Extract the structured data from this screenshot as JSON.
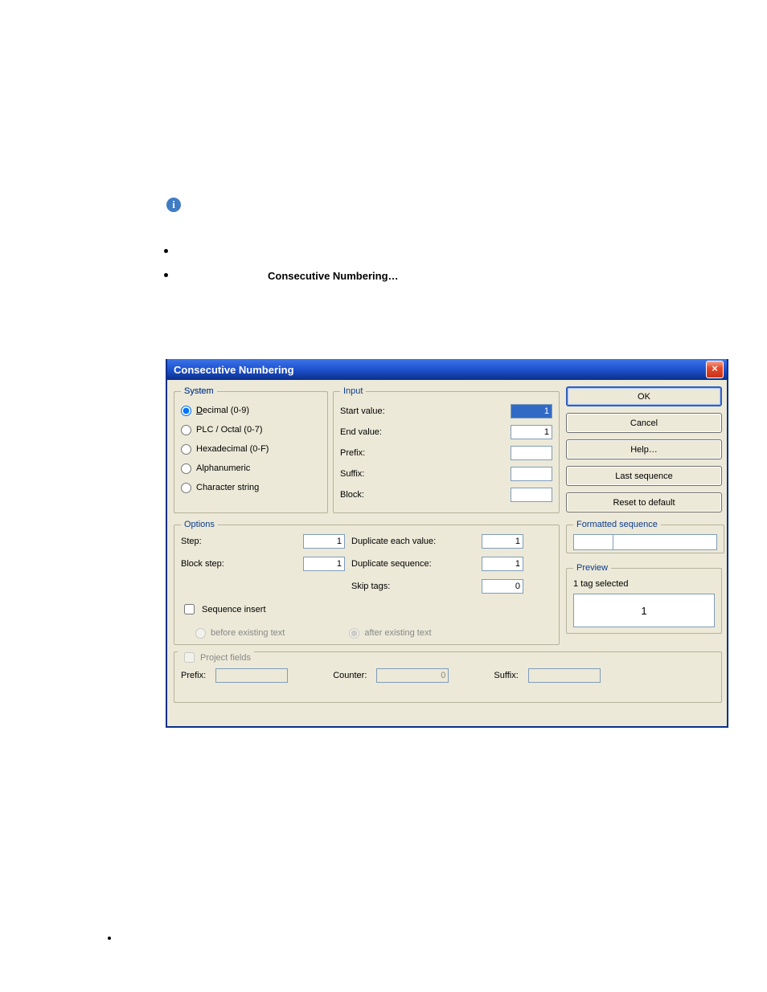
{
  "page": {
    "menu_text": "Consecutive Numbering…"
  },
  "dialog": {
    "title": "Consecutive Numbering",
    "close_icon": "×"
  },
  "system": {
    "legend": "System",
    "decimal": "Decimal (0-9)",
    "plc": "PLC / Octal (0-7)",
    "hex": "Hexadecimal (0-F)",
    "alpha": "Alphanumeric",
    "charstr": "Character string"
  },
  "input": {
    "legend": "Input",
    "start_label": "Start value:",
    "start_value": "1",
    "end_label": "End value:",
    "end_value": "1",
    "prefix_label": "Prefix:",
    "prefix_value": "",
    "suffix_label": "Suffix:",
    "suffix_value": "",
    "block_label": "Block:",
    "block_value": ""
  },
  "buttons": {
    "ok": "OK",
    "cancel": "Cancel",
    "help": "Help…",
    "last": "Last sequence",
    "reset": "Reset to default"
  },
  "options": {
    "legend": "Options",
    "step_label": "Step:",
    "step_value": "1",
    "blockstep_label": "Block step:",
    "blockstep_value": "1",
    "dup_value_label": "Duplicate each value:",
    "dup_value": "1",
    "dup_seq_label": "Duplicate sequence:",
    "dup_seq": "1",
    "skip_label": "Skip tags:",
    "skip_value": "0",
    "seq_insert": "Sequence insert",
    "before": "before existing text",
    "after": "after existing text"
  },
  "formatted": {
    "legend": "Formatted sequence"
  },
  "preview": {
    "legend": "Preview",
    "status": "1 tag selected",
    "value": "1"
  },
  "project": {
    "legend": "Project fields",
    "prefix_label": "Prefix:",
    "prefix_value": "",
    "counter_label": "Counter:",
    "counter_value": "0",
    "suffix_label": "Suffix:",
    "suffix_value": ""
  }
}
